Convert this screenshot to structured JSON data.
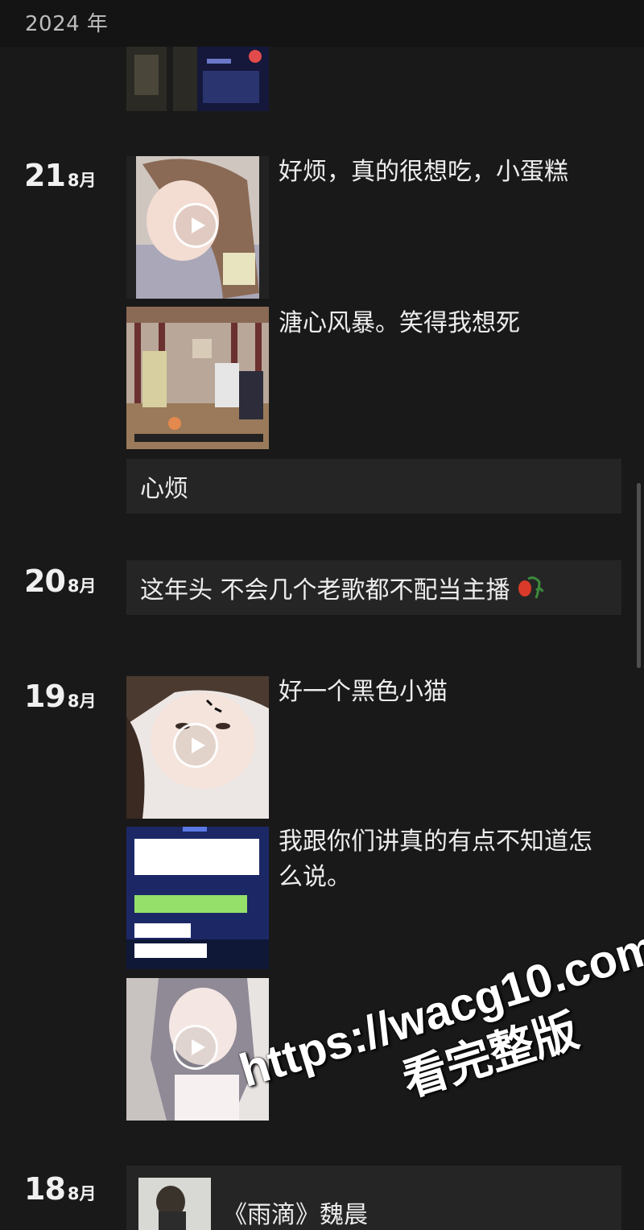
{
  "header": {
    "year": "2024 年"
  },
  "entries": [
    {
      "day": "21",
      "month": "8月",
      "posts": [
        {
          "caption": "好烦，真的很想吃，小蛋糕",
          "media": "video"
        },
        {
          "caption": "溏心风暴。笑得我想死",
          "media": "image"
        }
      ],
      "text_post": "心烦"
    },
    {
      "day": "20",
      "month": "8月",
      "text_post": "这年头 不会几个老歌都不配当主播",
      "emoji": "wilted-rose-icon"
    },
    {
      "day": "19",
      "month": "8月",
      "posts": [
        {
          "caption": "好一个黑色小猫",
          "media": "video"
        },
        {
          "caption": "我跟你们讲真的有点不知道怎么说。",
          "media": "image"
        },
        {
          "caption": "",
          "media": "video"
        }
      ]
    },
    {
      "day": "18",
      "month": "8月",
      "text_post": "《雨滴》魏晨"
    }
  ],
  "watermark": {
    "url": "https://wacg10.com",
    "subtitle": "看完整版"
  },
  "colors": {
    "background": "#191919",
    "header": "#141414",
    "text_box": "#252525"
  }
}
